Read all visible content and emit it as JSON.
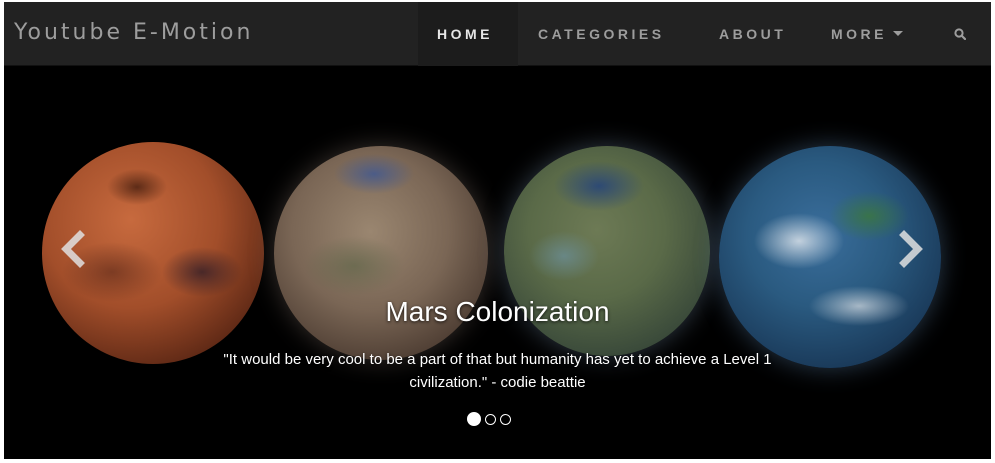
{
  "navbar": {
    "brand": "Youtube E-Motion",
    "items": [
      {
        "label": "HOME",
        "active": true
      },
      {
        "label": "CATEGORIES",
        "active": false
      },
      {
        "label": "ABOUT",
        "active": false
      },
      {
        "label": "MORE",
        "active": false,
        "dropdown": true
      }
    ],
    "search_icon": "search-icon"
  },
  "carousel": {
    "slide_title": "Mars Colonization",
    "slide_caption": "\"It would be very cool to be a part of that but humanity has yet to achieve a Level 1 civilization.\" - codie beattie",
    "slides_total": 3,
    "active_slide": 1,
    "prev_icon": "chevron-left-icon",
    "next_icon": "chevron-right-icon"
  },
  "colors": {
    "navbar_bg": "#222222",
    "nav_text": "#9d9d9d",
    "nav_active_text": "#e6e6e6",
    "carousel_bg": "#000000",
    "caption_text": "#ffffff"
  }
}
